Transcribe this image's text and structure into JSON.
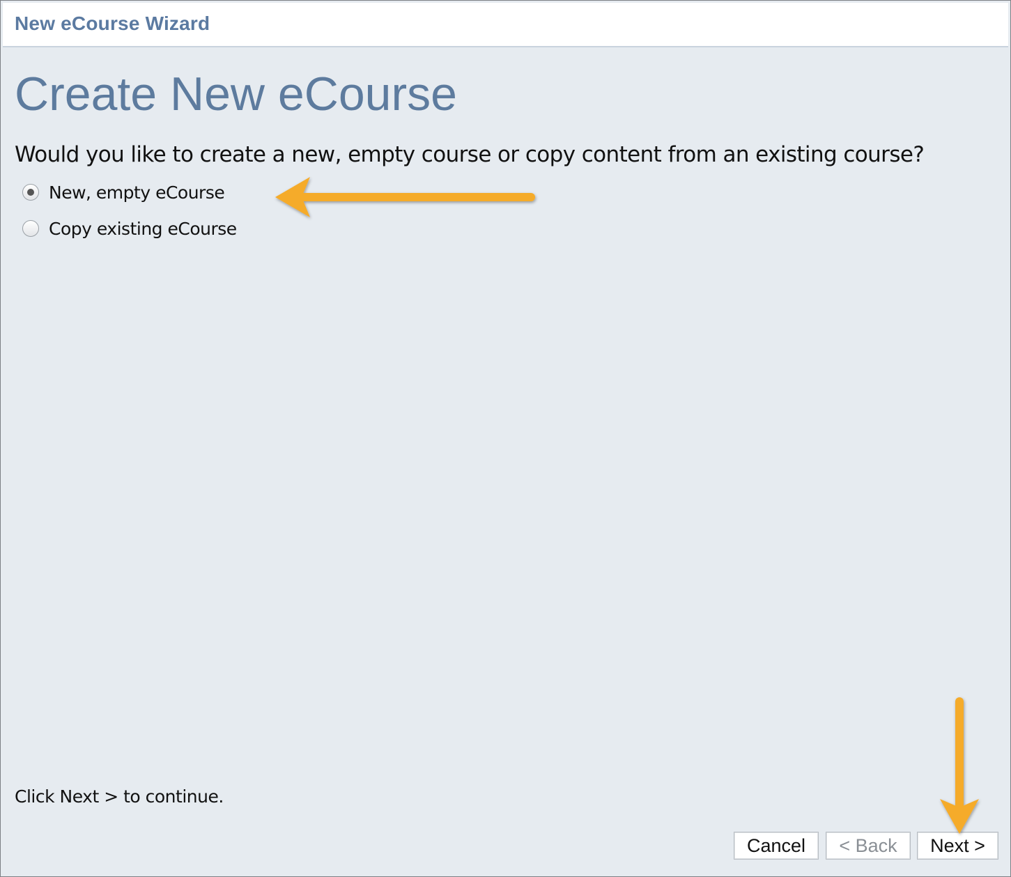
{
  "window": {
    "title": "New eCourse Wizard"
  },
  "page": {
    "heading": "Create New eCourse",
    "question": "Would you like to create a new, empty course or copy content from an existing course?",
    "options": [
      {
        "label": "New, empty eCourse",
        "selected": true
      },
      {
        "label": "Copy existing eCourse",
        "selected": false
      }
    ],
    "hint": "Click Next > to continue."
  },
  "buttons": {
    "cancel": "Cancel",
    "back": "< Back",
    "next": "Next >"
  },
  "colors": {
    "accent": "#5b7aa1",
    "annotation_arrow": "#f5ab2b",
    "background": "#e6ebf0"
  }
}
